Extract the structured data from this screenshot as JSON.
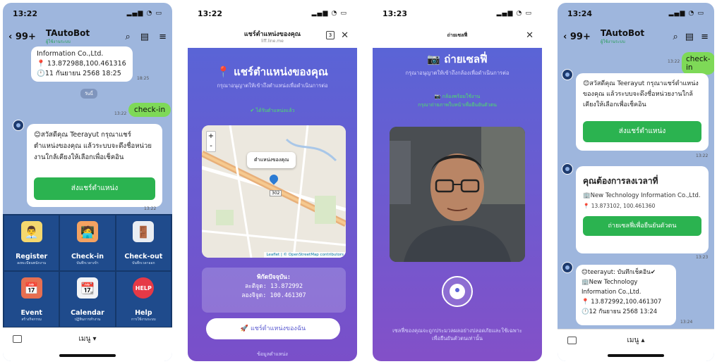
{
  "screen1": {
    "time": "13:22",
    "bot_name": "TAutoBot",
    "bot_subtitle": "ผู้ใช้งานระบบ",
    "back_count": "99+",
    "top_card_lines": [
      "Information Co.,Ltd.",
      "📍 13.872988,100.461316",
      "🕛11 กันยายน 2568 18:25"
    ],
    "top_card_time": "18:25",
    "date_chip": "วันนี้",
    "my_message": "check-in",
    "my_message_time": "13:22",
    "greeting": "😊สวัสดีคุณ Teerayut กรุณาแชร์ตำแหน่งของคุณ แล้วระบบจะดึงชื่อหน่วยงานใกล้เคียงให้เลือกเพื่อเช็คอิน",
    "share_button": "ส่งแชร์ตำแหน่ง",
    "greeting_time": "13:22",
    "menu_tiles": [
      {
        "label": "Register",
        "sub": "ลงทะเบียนพนักงาน",
        "icon": "👨‍💼"
      },
      {
        "label": "Check-in",
        "sub": "บันทึกเวลาเข้า",
        "icon": "🧑‍💻"
      },
      {
        "label": "Check-out",
        "sub": "บันทึกเวลาออก",
        "icon": "🚪"
      },
      {
        "label": "Event",
        "sub": "สร้างกิจกรรม",
        "icon": "📅"
      },
      {
        "label": "Calendar",
        "sub": "ปฏิทินการทำงาน",
        "icon": "📆"
      },
      {
        "label": "Help",
        "sub": "การใช้งานระบบ",
        "icon": "HELP"
      }
    ],
    "menu_label": "เมนู ▾"
  },
  "screen2": {
    "time": "13:22",
    "header_title": "แชร์ตำแหน่งของคุณ",
    "header_url": "liff.line.me",
    "big_title": "📍 แชร์ตำแหน่งของคุณ",
    "subtitle": "กรุณาอนุญาตให้เข้าถึงตำแหน่งเพื่อดำเนินการต่อ",
    "green_status": "✔ ได้รับตำแหน่งแล้ว",
    "map_popup": "ตำแหน่งของคุณ",
    "map_road": "302",
    "map_attribution": "Leaflet | © OpenStreetMap contributors",
    "coord_title": "พิกัดปัจจุบัน:",
    "lat_line": "ละติจูด: 13.872992",
    "lng_line": "ลองจิจูด: 100.461307",
    "share_button": "🚀 แชร์ตำแหน่งของฉัน",
    "bottom_note": "ข้อมูลตำแหน่ง"
  },
  "screen3": {
    "time": "13:23",
    "header_title": "ถ่ายเซลฟี่",
    "big_title": "📷 ถ่ายเซลฟี่",
    "subtitle": "กรุณาอนุญาตให้เข้าถึงกล้องเพื่อดำเนินการต่อ",
    "green_status": "📷 กล้องพร้อมใช้งาน",
    "green_status2": "กรุณาถ่ายภาพใบหน้าเพื่อยืนยันตัวตน",
    "footer_note": "เซลฟี่ของคุณจะถูกประมวลผลอย่างปลอดภัยและใช้เฉพาะเพื่อยืนยันตัวตนเท่านั้น"
  },
  "screen4": {
    "time": "13:24",
    "bot_name": "TAutoBot",
    "back_count": "99+",
    "my_message": "check-in",
    "my_message_time": "13:22",
    "greeting": "😊สวัสดีคุณ Teerayut กรุณาแชร์ตำแหน่งของคุณ แล้วระบบจะดึงชื่อหน่วยงานใกล้เคียงให้เลือกเพื่อเช็คอิน",
    "share_button": "ส่งแชร์ตำแหน่ง",
    "greeting_time": "13:22",
    "card_title": "คุณต้องการลงเวลาที่",
    "card_company": "🏢New Technology Information Co.,Ltd.",
    "card_coords": "📍 13.873102, 100.461360",
    "selfie_button": "ถ่ายเซลฟี่เพื่อยืนยันตัวตน",
    "card_time": "13:23",
    "result_lines": [
      "😊teerayut: บันทึกเช็คอิน✔",
      "🏢New Technology",
      "Information Co.,Ltd.",
      "📍 13.872992,100.461307",
      "🕛12 กันยายน 2568 13:24"
    ],
    "result_time": "13:24",
    "menu_label": "เมนู ▴"
  },
  "colors": {
    "line_bg": "#9eb6dd",
    "green": "#2bb350",
    "purple": "#5a64d6",
    "rich_menu": "#1f4b8c"
  }
}
